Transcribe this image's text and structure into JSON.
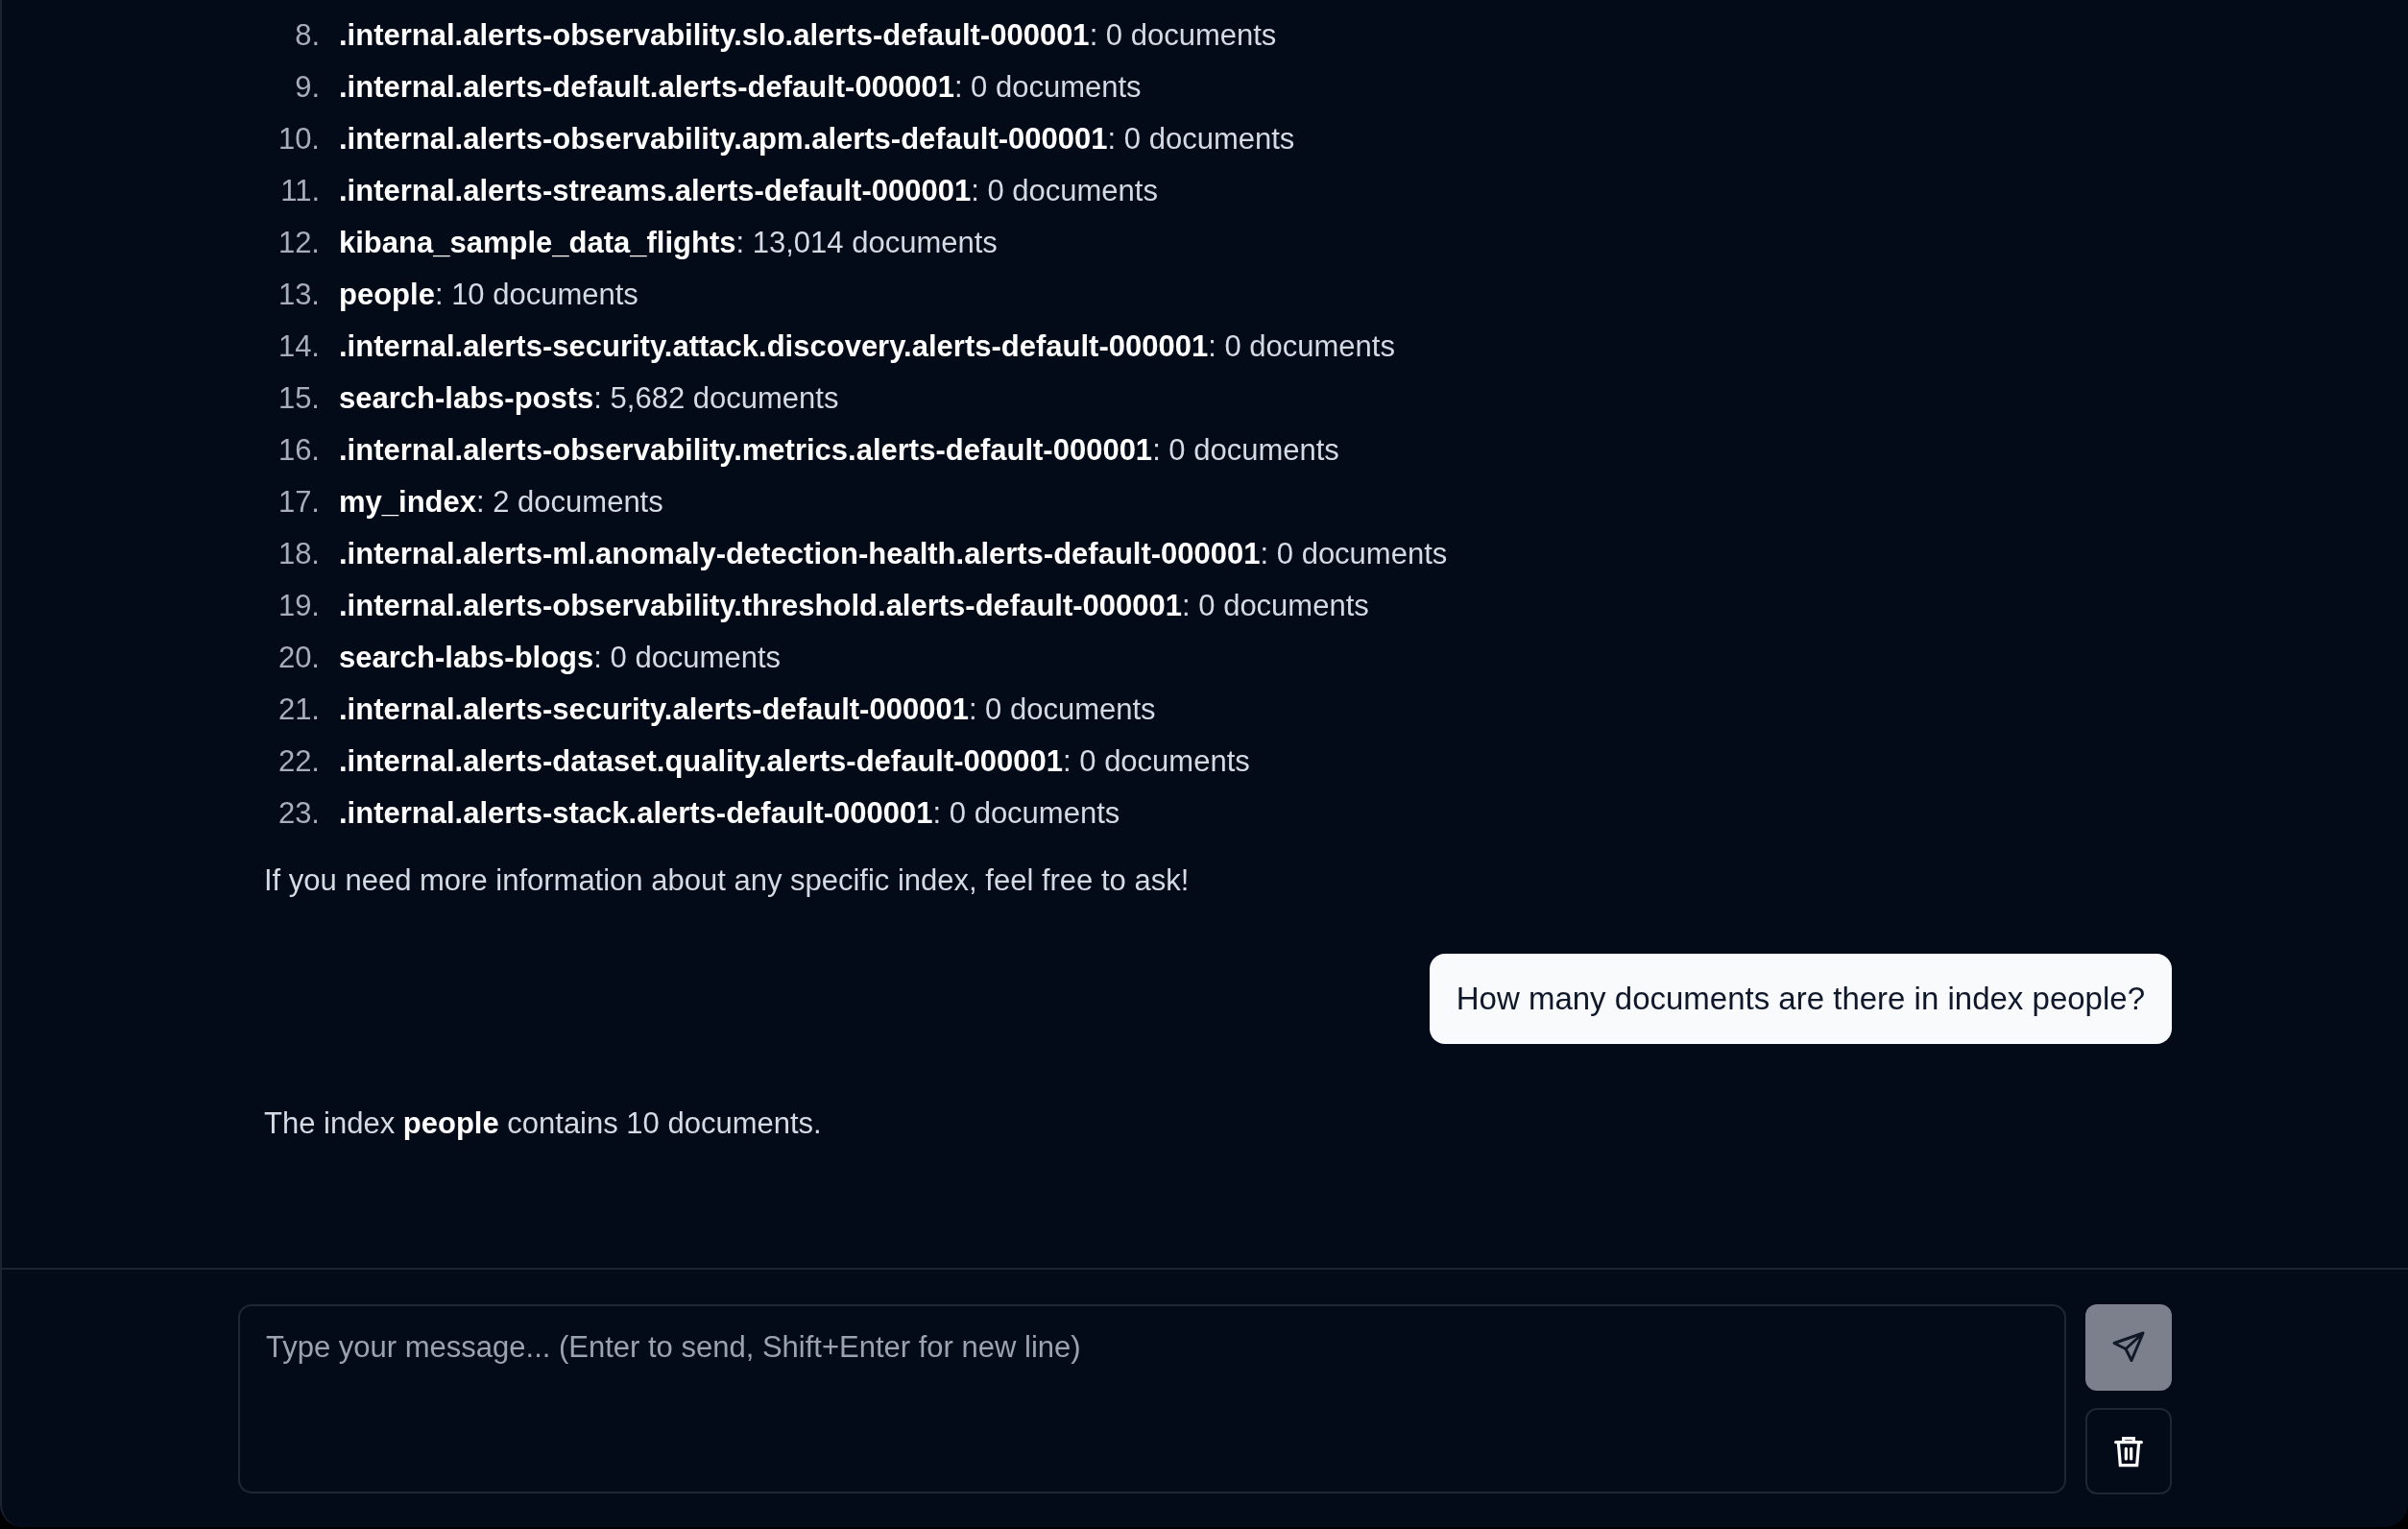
{
  "assistant_list": [
    {
      "number": "8.",
      "text": "**.internal.alerts-observability.slo.alerts-default-000001**: 0 documents"
    },
    {
      "number": "9.",
      "text": "**.internal.alerts-default.alerts-default-000001**: 0 documents"
    },
    {
      "number": "10.",
      "text": "**.internal.alerts-observability.apm.alerts-default-000001**: 0 documents"
    },
    {
      "number": "11.",
      "text": "**.internal.alerts-streams.alerts-default-000001**: 0 documents"
    },
    {
      "number": "12.",
      "text": "**kibana_sample_data_flights**: 13,014 documents"
    },
    {
      "number": "13.",
      "text": "**people**: 10 documents"
    },
    {
      "number": "14.",
      "text": "**.internal.alerts-security.attack.discovery.alerts-default-000001**: 0 documents"
    },
    {
      "number": "15.",
      "text": "**search-labs-posts**: 5,682 documents"
    },
    {
      "number": "16.",
      "text": "**.internal.alerts-observability.metrics.alerts-default-000001**: 0 documents"
    },
    {
      "number": "17.",
      "text": "**my_index**: 2 documents"
    },
    {
      "number": "18.",
      "text": "**.internal.alerts-ml.anomaly-detection-health.alerts-default-000001**: 0 documents"
    },
    {
      "number": "19.",
      "text": "**.internal.alerts-observability.threshold.alerts-default-000001**: 0 documents"
    },
    {
      "number": "20.",
      "text": "**search-labs-blogs**: 0 documents"
    },
    {
      "number": "21.",
      "text": "**.internal.alerts-security.alerts-default-000001**: 0 documents"
    },
    {
      "number": "22.",
      "text": "**.internal.alerts-dataset.quality.alerts-default-000001**: 0 documents"
    },
    {
      "number": "23.",
      "text": "**.internal.alerts-stack.alerts-default-000001**: 0 documents"
    }
  ],
  "assistant_closing": "If you need more information about any specific index, feel free to ask!",
  "user_message": "How many documents are there in index people?",
  "assistant_reply": "The index **people** contains 10 documents.",
  "composer": {
    "placeholder": "Type your message... (Enter to send, Shift+Enter for new line)",
    "send_disabled": true
  }
}
